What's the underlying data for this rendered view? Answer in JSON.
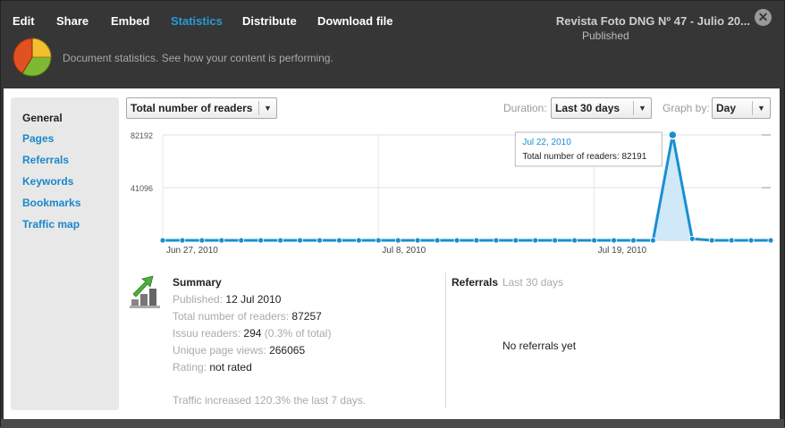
{
  "tabs": [
    {
      "label": "Edit"
    },
    {
      "label": "Share"
    },
    {
      "label": "Embed"
    },
    {
      "label": "Statistics",
      "active": true
    },
    {
      "label": "Distribute"
    },
    {
      "label": "Download file"
    }
  ],
  "document": {
    "title": "Revista Foto DNG Nº 47 - Julio 20...",
    "status": "Published"
  },
  "header": {
    "tagline": "Document statistics. See how your content is performing.",
    "close_symbol": "✕"
  },
  "sidebar": {
    "items": [
      {
        "label": "General",
        "active": true
      },
      {
        "label": "Pages"
      },
      {
        "label": "Referrals"
      },
      {
        "label": "Keywords"
      },
      {
        "label": "Bookmarks"
      },
      {
        "label": "Traffic map"
      }
    ]
  },
  "controls": {
    "metric": "Total number of readers",
    "duration_label": "Duration:",
    "duration": "Last 30 days",
    "graph_by_label": "Graph by:",
    "graph_by": "Day",
    "arrow": "▼"
  },
  "chart_data": {
    "type": "area",
    "ylim": [
      0,
      82192
    ],
    "yticks": [
      "82192",
      "41096"
    ],
    "xtick_labels": [
      "Jun 27, 2010",
      "Jul 8, 2010",
      "Jul 19, 2010"
    ],
    "series": [
      {
        "values": [
          0,
          0,
          0,
          0,
          0,
          0,
          0,
          0,
          0,
          0,
          0,
          0,
          0,
          0,
          0,
          0,
          0,
          0,
          0,
          0,
          0,
          0,
          0,
          0,
          0,
          0,
          82191,
          1200,
          0,
          0,
          0,
          0
        ]
      }
    ],
    "tooltip": {
      "date": "Jul 22, 2010",
      "text": "Total number of readers: 82191"
    },
    "color": "#1a8fd0",
    "fill": "#cfe9f8"
  },
  "summary": {
    "title": "Summary",
    "published_label": "Published:",
    "published": "12 Jul 2010",
    "readers_label": "Total number of readers:",
    "readers": "87257",
    "issuu_label": "Issuu readers:",
    "issuu": "294",
    "issuu_pct": "(0.3% of total)",
    "views_label": "Unique page views:",
    "views": "266065",
    "rating_label": "Rating:",
    "rating": "not rated",
    "footer": "Traffic increased 120.3% the last 7 days."
  },
  "referrals": {
    "title": "Referrals",
    "subtitle": "Last 30 days",
    "empty": "No referrals yet"
  }
}
